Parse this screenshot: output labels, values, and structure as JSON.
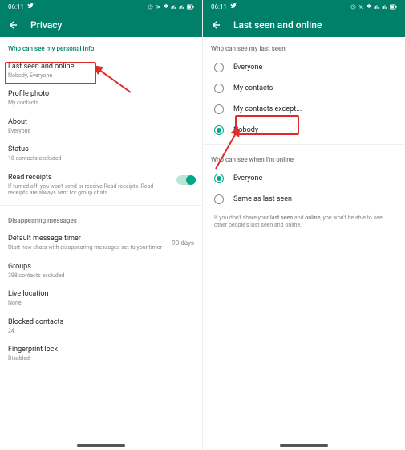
{
  "status": {
    "time": "06:11"
  },
  "left": {
    "title": "Privacy",
    "section1": "Who can see my personal info",
    "items": {
      "lastseen": {
        "title": "Last seen and online",
        "sub": "Nobody, Everyone"
      },
      "photo": {
        "title": "Profile photo",
        "sub": "My contacts"
      },
      "about": {
        "title": "About",
        "sub": "Everyone"
      },
      "status": {
        "title": "Status",
        "sub": "18 contacts excluded"
      },
      "receipts": {
        "title": "Read receipts",
        "sub": "If turned off, you won't send or receive Read receipts. Read receipts are always sent for group chats."
      }
    },
    "section2": "Disappearing messages",
    "items2": {
      "timer": {
        "title": "Default message timer",
        "sub": "Start new chats with disappearing messages set to your timer",
        "value": "90 days"
      },
      "groups": {
        "title": "Groups",
        "sub": "398 contacts excluded"
      },
      "live": {
        "title": "Live location",
        "sub": "None"
      },
      "blocked": {
        "title": "Blocked contacts",
        "sub": "24"
      },
      "finger": {
        "title": "Fingerprint lock",
        "sub": "Disabled"
      }
    }
  },
  "right": {
    "title": "Last seen and online",
    "section1": "Who can see my last seen",
    "opts1": {
      "0": "Everyone",
      "1": "My contacts",
      "2": "My contacts except...",
      "3": "Nobody"
    },
    "section2": "Who can see when I'm online",
    "opts2": {
      "0": "Everyone",
      "1": "Same as last seen"
    },
    "info_pre": "If you don't share your ",
    "info_b1": "last seen",
    "info_mid": " and ",
    "info_b2": "online",
    "info_post": ", you won't be able to see other people's last seen and online."
  }
}
